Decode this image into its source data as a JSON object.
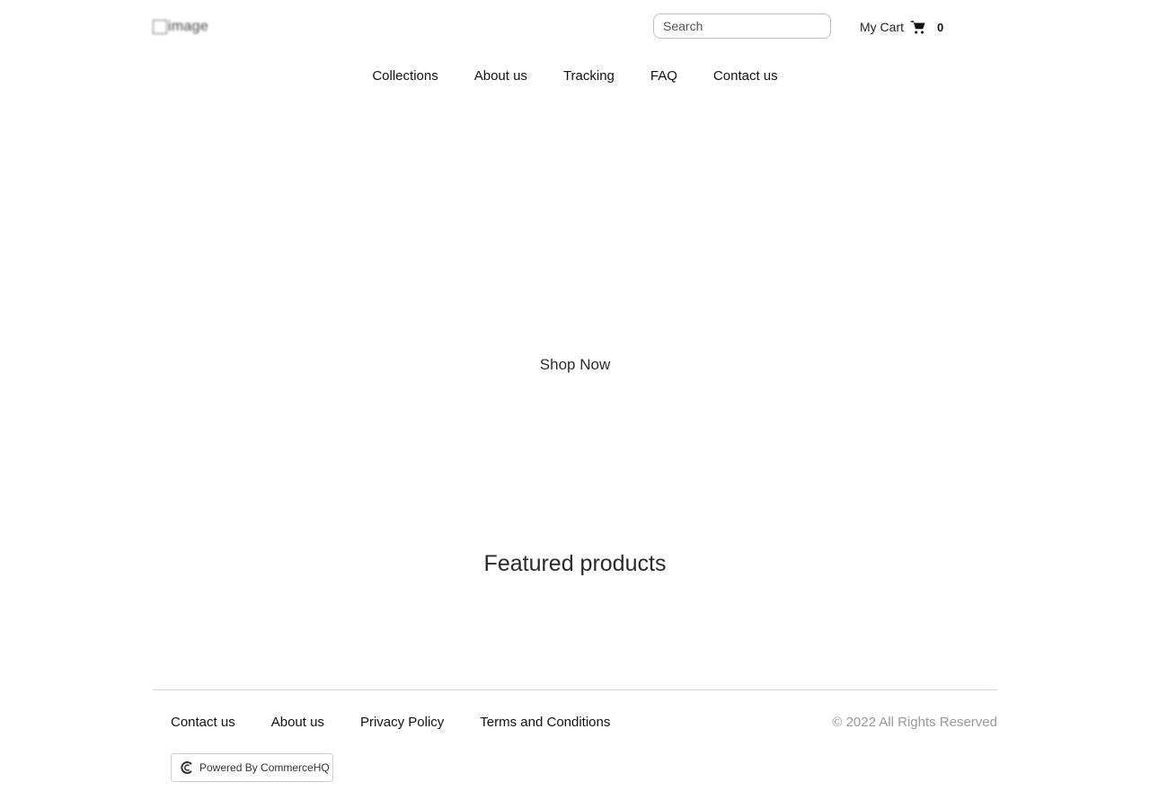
{
  "header": {
    "logo_alt": "image",
    "search": {
      "placeholder": "Search",
      "value": ""
    },
    "cart": {
      "label": "My Cart",
      "count": "0",
      "icon": "cart-icon"
    }
  },
  "nav": {
    "items": [
      {
        "label": "Collections"
      },
      {
        "label": "About us"
      },
      {
        "label": "Tracking"
      },
      {
        "label": "FAQ"
      },
      {
        "label": "Contact us"
      }
    ]
  },
  "hero": {
    "cta_label": "Shop Now"
  },
  "featured": {
    "title": "Featured products"
  },
  "footer": {
    "links": [
      {
        "label": "Contact us"
      },
      {
        "label": "About us"
      },
      {
        "label": "Privacy Policy"
      },
      {
        "label": "Terms and Conditions"
      }
    ],
    "copyright": "© 2022 All Rights Reserved",
    "powered_by": {
      "label": "Powered By CommerceHQ",
      "icon": "commercehq-logo-icon"
    }
  }
}
